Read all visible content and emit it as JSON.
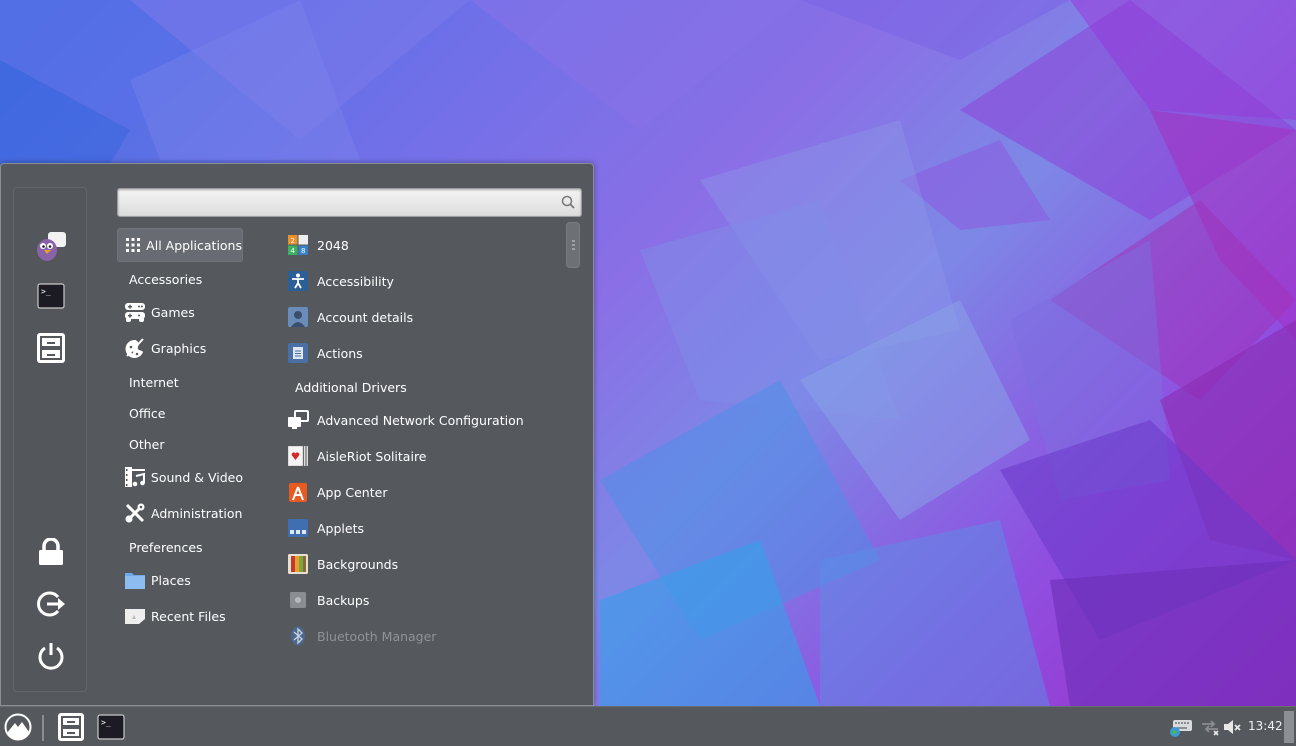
{
  "search": {
    "placeholder": "",
    "value": ""
  },
  "favorites": [
    {
      "name": "pidgin",
      "label": "Pidgin"
    },
    {
      "name": "terminal",
      "label": "Terminal"
    },
    {
      "name": "files",
      "label": "Files"
    }
  ],
  "session": [
    {
      "name": "lock-screen",
      "label": "Lock Screen"
    },
    {
      "name": "logout",
      "label": "Logout"
    },
    {
      "name": "shutdown",
      "label": "Quit"
    }
  ],
  "categories": [
    {
      "label": "All Applications",
      "icon": "grid-icon",
      "selected": true
    },
    {
      "label": "Accessories",
      "icon": null
    },
    {
      "label": "Games",
      "icon": "gamepad-icon"
    },
    {
      "label": "Graphics",
      "icon": "palette-icon"
    },
    {
      "label": "Internet",
      "icon": null
    },
    {
      "label": "Office",
      "icon": null
    },
    {
      "label": "Other",
      "icon": null
    },
    {
      "label": "Sound & Video",
      "icon": "film-music-icon"
    },
    {
      "label": "Administration",
      "icon": "tools-icon"
    },
    {
      "label": "Preferences",
      "icon": null
    },
    {
      "label": "Places",
      "icon": "folder-icon"
    },
    {
      "label": "Recent Files",
      "icon": "recent-file-icon"
    }
  ],
  "apps": [
    {
      "label": "2048",
      "icon": "2048-icon"
    },
    {
      "label": "Accessibility",
      "icon": "accessibility-icon"
    },
    {
      "label": "Account details",
      "icon": "account-icon"
    },
    {
      "label": "Actions",
      "icon": "actions-icon"
    },
    {
      "label": "Additional Drivers",
      "icon": null
    },
    {
      "label": "Advanced Network Configuration",
      "icon": "network-config-icon"
    },
    {
      "label": "AisleRiot Solitaire",
      "icon": "cards-icon"
    },
    {
      "label": "App Center",
      "icon": "app-center-icon"
    },
    {
      "label": "Applets",
      "icon": "applets-icon"
    },
    {
      "label": "Backgrounds",
      "icon": "backgrounds-icon"
    },
    {
      "label": "Backups",
      "icon": "backups-icon"
    },
    {
      "label": "Bluetooth Manager",
      "icon": "bluetooth-icon",
      "dim": true
    }
  ],
  "taskbar": {
    "menu_label": "Menu",
    "launchers": [
      "Files",
      "Terminal"
    ],
    "clock": "13:42"
  },
  "colors": {
    "menu_bg": "#55595e",
    "selected_bg": "#686c72",
    "panel_bg": "#55595e"
  }
}
